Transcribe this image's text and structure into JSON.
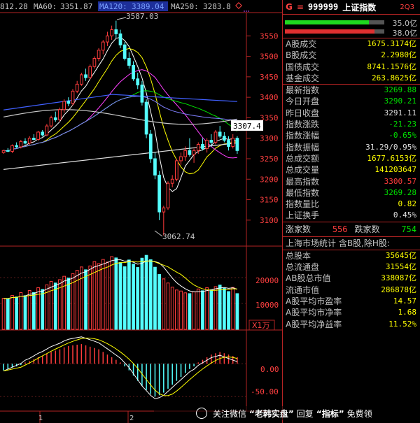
{
  "top_bar": {
    "ma_prev_value": "812.28",
    "ma60_label": "MA60:",
    "ma60_value": "3351.87",
    "ma120_label": "MA120:",
    "ma120_value": "3389.04",
    "ma250_label": "MA250:",
    "ma250_value": "3283.8"
  },
  "price_axis": {
    "ticks": [
      "3550",
      "3500",
      "3450",
      "3400",
      "3350",
      "3300",
      "3250",
      "3200",
      "3150",
      "3100"
    ],
    "current_price_tag": "3307.4",
    "high_annotation": "3587.03",
    "low_annotation": "3062.74"
  },
  "volume_axis": {
    "ticks": [
      "20000",
      "10000"
    ],
    "unit_label": "X1万"
  },
  "macd_axis": {
    "ticks": [
      "0.00",
      "-50.00"
    ]
  },
  "time_axis": {
    "labels": [
      "1",
      "2"
    ]
  },
  "panel": {
    "header": {
      "g_label": "G",
      "menu_icon": "≡",
      "code": "999999",
      "name": "上证指数",
      "badge": "2Q3"
    },
    "ratio_bars": [
      {
        "value": "35.0亿",
        "fraction": 0.78,
        "color": "#1fd81f"
      },
      {
        "value": "38.0亿",
        "fraction": 0.84,
        "color": "#e03030"
      }
    ],
    "turnover": [
      {
        "label": "A股成交",
        "value": "1675.3174亿",
        "cls": "y"
      },
      {
        "label": "B股成交",
        "value": "2.2980亿",
        "cls": "y"
      },
      {
        "label": "国债成交",
        "value": "8741.1576亿",
        "cls": "y"
      },
      {
        "label": "基金成交",
        "value": "263.8625亿",
        "cls": "y"
      }
    ],
    "quote": [
      {
        "label": "最新指数",
        "value": "3269.88",
        "cls": "gr"
      },
      {
        "label": "今日开盘",
        "value": "3290.21",
        "cls": "gr"
      },
      {
        "label": "昨日收盘",
        "value": "3291.11",
        "cls": "w"
      },
      {
        "label": "指数涨跌",
        "value": "-21.23",
        "cls": "gr"
      },
      {
        "label": "指数涨幅",
        "value": "-0.65%",
        "cls": "gr"
      },
      {
        "label": "指数振幅",
        "value": "31.29/0.95%",
        "cls": "w"
      },
      {
        "label": "总成交额",
        "value": "1677.6153亿",
        "cls": "y"
      },
      {
        "label": "总成交量",
        "value": "141203647",
        "cls": "y"
      },
      {
        "label": "最高指数",
        "value": "3300.57",
        "cls": "r"
      },
      {
        "label": "最低指数",
        "value": "3269.28",
        "cls": "gr"
      },
      {
        "label": "指数量比",
        "value": "0.82",
        "cls": "y"
      },
      {
        "label": "上证换手",
        "value": "0.45%",
        "cls": "w"
      }
    ],
    "updown": {
      "up_label": "涨家数",
      "up_value": "556",
      "down_label": "跌家数",
      "down_value": "754"
    },
    "stats_header": "上海市场统计 含B股,除H股:",
    "stats": [
      {
        "label": "总股本",
        "value": "35645亿"
      },
      {
        "label": "总流通盘",
        "value": "31554亿"
      },
      {
        "label": "AB股总市值",
        "value": "338087亿"
      },
      {
        "label": "流通市值",
        "value": "286878亿"
      },
      {
        "label": "A股平均市盈率",
        "value": "14.57"
      },
      {
        "label": "A股平均市净率",
        "value": "1.68"
      },
      {
        "label": "A股平均净益率",
        "value": "11.52%"
      }
    ]
  },
  "watermark": {
    "text1": "关注微信",
    "text2": "“老韩实盘”",
    "text3": "回复",
    "text4": "“指标”",
    "text5": "免费领"
  },
  "chart_data": {
    "type": "candlestick",
    "price_ylim": [
      3040,
      3600
    ],
    "candles": [
      [
        3265,
        3272,
        3262,
        3270
      ],
      [
        3270,
        3276,
        3266,
        3268
      ],
      [
        3268,
        3285,
        3264,
        3282
      ],
      [
        3282,
        3290,
        3276,
        3279
      ],
      [
        3279,
        3296,
        3275,
        3292
      ],
      [
        3292,
        3300,
        3285,
        3288
      ],
      [
        3288,
        3305,
        3284,
        3300
      ],
      [
        3300,
        3310,
        3295,
        3297
      ],
      [
        3297,
        3318,
        3294,
        3315
      ],
      [
        3315,
        3320,
        3304,
        3308
      ],
      [
        3308,
        3335,
        3305,
        3330
      ],
      [
        3330,
        3355,
        3326,
        3350
      ],
      [
        3350,
        3365,
        3340,
        3345
      ],
      [
        3345,
        3375,
        3340,
        3370
      ],
      [
        3370,
        3395,
        3362,
        3390
      ],
      [
        3390,
        3400,
        3378,
        3385
      ],
      [
        3385,
        3420,
        3380,
        3415
      ],
      [
        3415,
        3440,
        3410,
        3432
      ],
      [
        3432,
        3460,
        3428,
        3455
      ],
      [
        3455,
        3470,
        3440,
        3448
      ],
      [
        3448,
        3480,
        3444,
        3475
      ],
      [
        3475,
        3500,
        3470,
        3495
      ],
      [
        3495,
        3520,
        3488,
        3515
      ],
      [
        3515,
        3540,
        3505,
        3535
      ],
      [
        3535,
        3560,
        3525,
        3550
      ],
      [
        3550,
        3575,
        3540,
        3565
      ],
      [
        3565,
        3587.03,
        3545,
        3555
      ],
      [
        3555,
        3565,
        3520,
        3528
      ],
      [
        3528,
        3535,
        3490,
        3495
      ],
      [
        3495,
        3510,
        3470,
        3478
      ],
      [
        3478,
        3488,
        3440,
        3445
      ],
      [
        3445,
        3460,
        3420,
        3430
      ],
      [
        3430,
        3440,
        3380,
        3388
      ],
      [
        3388,
        3395,
        3300,
        3310
      ],
      [
        3310,
        3320,
        3240,
        3250
      ],
      [
        3250,
        3265,
        3200,
        3210
      ],
      [
        3210,
        3220,
        3100,
        3120
      ],
      [
        3120,
        3135,
        3062.74,
        3130
      ],
      [
        3130,
        3195,
        3125,
        3190
      ],
      [
        3190,
        3210,
        3180,
        3200
      ],
      [
        3200,
        3250,
        3195,
        3245
      ],
      [
        3245,
        3265,
        3235,
        3255
      ],
      [
        3255,
        3280,
        3245,
        3270
      ],
      [
        3270,
        3300,
        3255,
        3260
      ],
      [
        3260,
        3275,
        3240,
        3270
      ],
      [
        3270,
        3290,
        3262,
        3285
      ],
      [
        3285,
        3300,
        3270,
        3275
      ],
      [
        3275,
        3300,
        3265,
        3295
      ],
      [
        3295,
        3310,
        3280,
        3290
      ],
      [
        3290,
        3320,
        3285,
        3315
      ],
      [
        3315,
        3330,
        3300,
        3305
      ],
      [
        3305,
        3315,
        3290,
        3295
      ],
      [
        3295,
        3305,
        3270,
        3280
      ],
      [
        3280,
        3310,
        3275,
        3300
      ],
      [
        3300,
        3305,
        3262,
        3270
      ]
    ],
    "volume": [
      12000,
      11800,
      13100,
      12500,
      14200,
      13000,
      15000,
      14200,
      16100,
      15400,
      17200,
      18500,
      17900,
      19200,
      20500,
      19800,
      21500,
      22800,
      24100,
      23000,
      24500,
      26200,
      25400,
      27000,
      26000,
      28100,
      27600,
      25800,
      24200,
      26800,
      25200,
      23900,
      27500,
      28600,
      26900,
      24000,
      21200,
      19500,
      17900,
      16300,
      15200,
      14800,
      14100,
      13800,
      14500,
      15600,
      14900,
      16100,
      15300,
      16500,
      17100,
      15800,
      14600,
      16200,
      13800
    ],
    "volume_ylim": [
      0,
      30000
    ],
    "macd_hist": [
      -10,
      -8,
      -6,
      -4,
      -2,
      2,
      4,
      7,
      10,
      12,
      15,
      18,
      20,
      22,
      25,
      27,
      28,
      29,
      30,
      28,
      26,
      24,
      22,
      18,
      14,
      10,
      6,
      2,
      -4,
      -10,
      -18,
      -26,
      -34,
      -40,
      -46,
      -50,
      -48,
      -44,
      -38,
      -32,
      -26,
      -20,
      -14,
      -8,
      -4,
      2,
      6,
      10,
      14,
      16,
      18,
      16,
      14,
      12,
      10
    ],
    "macd_ylim": [
      -70,
      45
    ]
  }
}
